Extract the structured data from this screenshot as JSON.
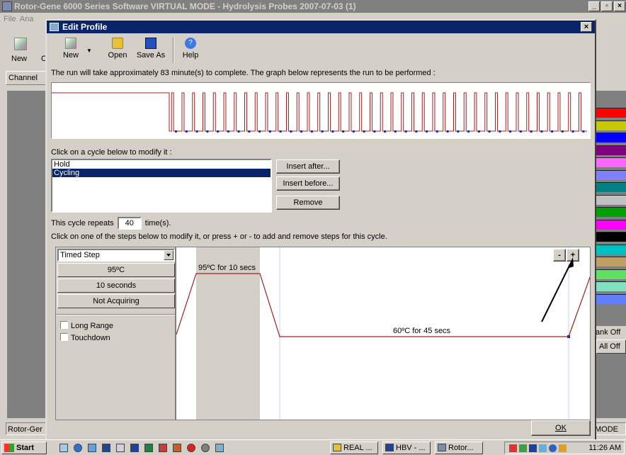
{
  "main_window": {
    "title": "Rotor-Gene 6000 Series Software VIRTUAL MODE - Hydrolysis Probes 2007-07-03 (1)",
    "menu": [
      "File",
      "Ana"
    ],
    "toolbar_new": "New",
    "toolbar_o": "O",
    "channel_label": "Channel",
    "right_panel": {
      "ank_off": "ank Off",
      "all_off": "All Off"
    },
    "status_left": "Rotor-Ger",
    "status_right": "MODE",
    "swatch_colors": [
      "#ff0000",
      "#c8c800",
      "#0000ff",
      "#800080",
      "#ff66ff",
      "#8080ff",
      "#008080",
      "#c0c0c0",
      "#00a000",
      "#ff00ff",
      "#000000",
      "#00c0c0",
      "#c0a060",
      "#60e060",
      "#80e0c0",
      "#6080ff"
    ]
  },
  "dialog": {
    "title": "Edit Profile",
    "toolbar": {
      "new": "New",
      "open": "Open",
      "save_as": "Save As",
      "help": "Help"
    },
    "info_text": "The run will take approximately 83 minute(s) to complete. The graph below represents the run to be performed :",
    "cycle_prompt": "Click on a cycle below to modify it :",
    "cycles": [
      "Hold",
      "Cycling"
    ],
    "selected_cycle": "Cycling",
    "buttons": {
      "insert_after": "Insert after...",
      "insert_before": "Insert before...",
      "remove": "Remove"
    },
    "repeat_prefix": "This cycle repeats",
    "repeat_count": "40",
    "repeat_suffix": "time(s).",
    "step_hint": "Click on one of the steps below to modify it, or press + or - to add and remove steps for this cycle.",
    "step": {
      "type": "Timed Step",
      "temperature": "95ºC",
      "duration": "10 seconds",
      "acquiring": "Not Acquiring",
      "long_range": "Long Range",
      "touchdown": "Touchdown"
    },
    "profile": {
      "step1_label": "95ºC for 10 secs",
      "step2_label": "60ºC for 45 secs",
      "minus": "-",
      "plus": "+"
    },
    "ok": "OK",
    "run_graph": {
      "hold_segments": 1,
      "cycles_shown": 40
    }
  },
  "taskbar": {
    "start": "Start",
    "tasks": [
      "REAL ...",
      "HBV - ...",
      "Rotor..."
    ],
    "clock": "11:26 AM"
  }
}
